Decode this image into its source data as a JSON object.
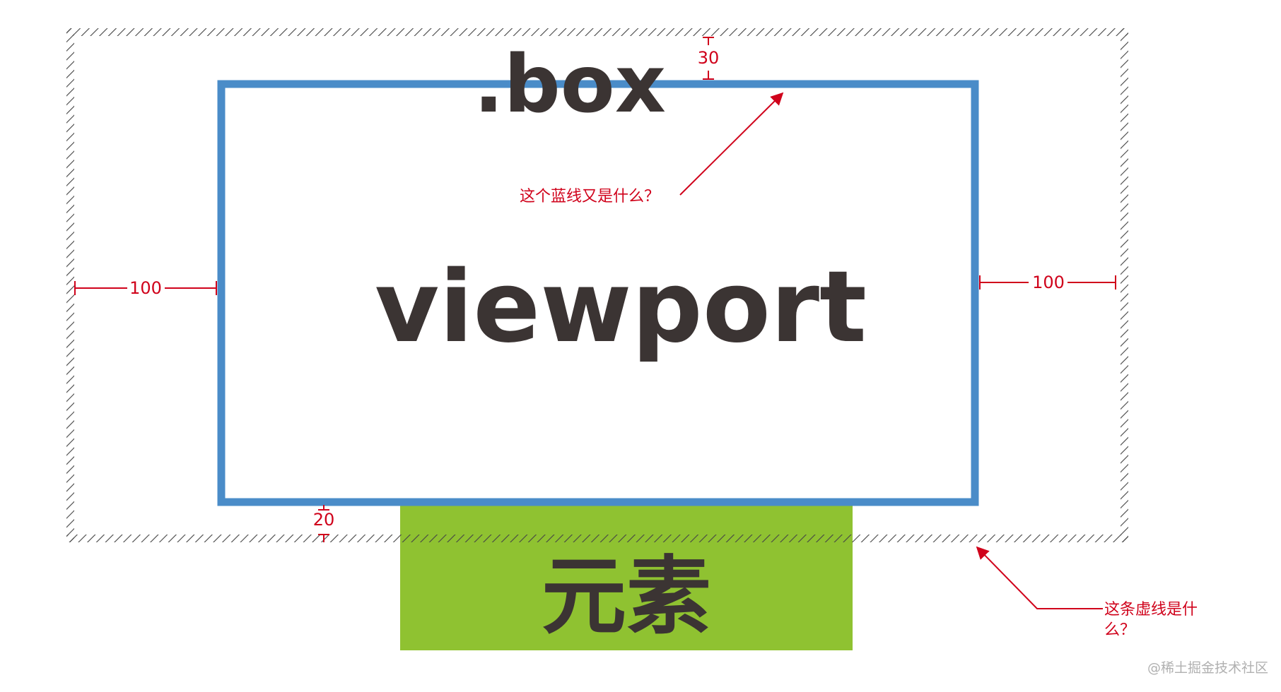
{
  "labels": {
    "box": ".box",
    "viewport": "viewport",
    "element": "元素",
    "top_gap": "30",
    "bottom_gap": "20",
    "left_gap": "100",
    "right_gap": "100",
    "blue_line_question": "这个蓝线又是什么？",
    "dashed_line_question_1": "这条虚线是什",
    "dashed_line_question_2": "么？",
    "watermark": "@稀土掘金技术社区"
  },
  "colors": {
    "viewport_border": "#4a8cc8",
    "element_fill": "#8fc231",
    "annotation": "#d0021b",
    "text_dark": "#3b3433",
    "hatch": "#444444"
  }
}
